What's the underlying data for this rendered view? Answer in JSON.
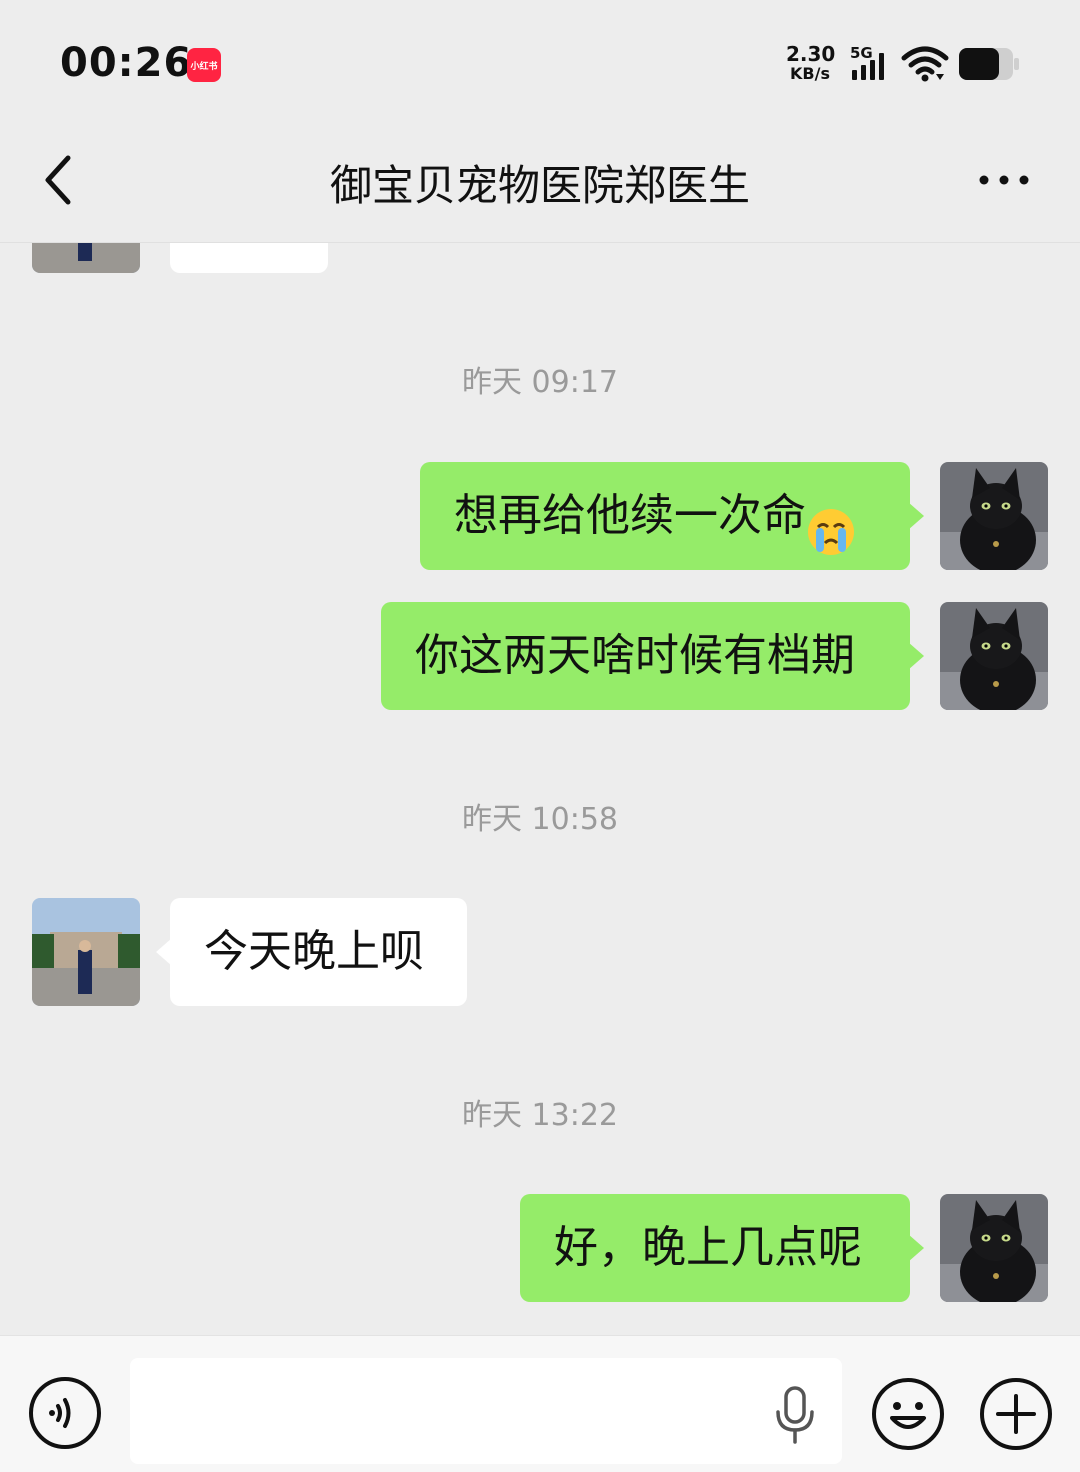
{
  "status_bar": {
    "time": "00:26",
    "app_badge": "小红书",
    "net_speed_value": "2.30",
    "net_speed_unit": "KB/s",
    "network_type": "5G",
    "icons": [
      "signal-icon",
      "wifi-icon",
      "battery-icon"
    ]
  },
  "header": {
    "title": "御宝贝宠物医院郑医生",
    "back_icon": "chevron-left-icon",
    "more_icon": "more-dots-icon"
  },
  "messages": [
    {
      "type": "time",
      "text": "昨天 09:17"
    },
    {
      "type": "outgoing",
      "text": "想再给他续一次命",
      "emoji": "crying-face-emoji"
    },
    {
      "type": "outgoing",
      "text": "你这两天啥时候有档期"
    },
    {
      "type": "time",
      "text": "昨天 10:58"
    },
    {
      "type": "incoming",
      "text": "今天晚上呗"
    },
    {
      "type": "time",
      "text": "昨天 13:22"
    },
    {
      "type": "outgoing",
      "text": "好，晚上几点呢"
    }
  ],
  "input_bar": {
    "placeholder": "",
    "value": "",
    "icons": [
      "voice-icon",
      "mic-icon",
      "emoji-icon",
      "plus-icon"
    ]
  },
  "colors": {
    "background": "#ededed",
    "outgoing_bubble": "#95ec69",
    "incoming_bubble": "#ffffff",
    "time_label": "#9a9a9a",
    "app_badge": "#ff2442"
  }
}
